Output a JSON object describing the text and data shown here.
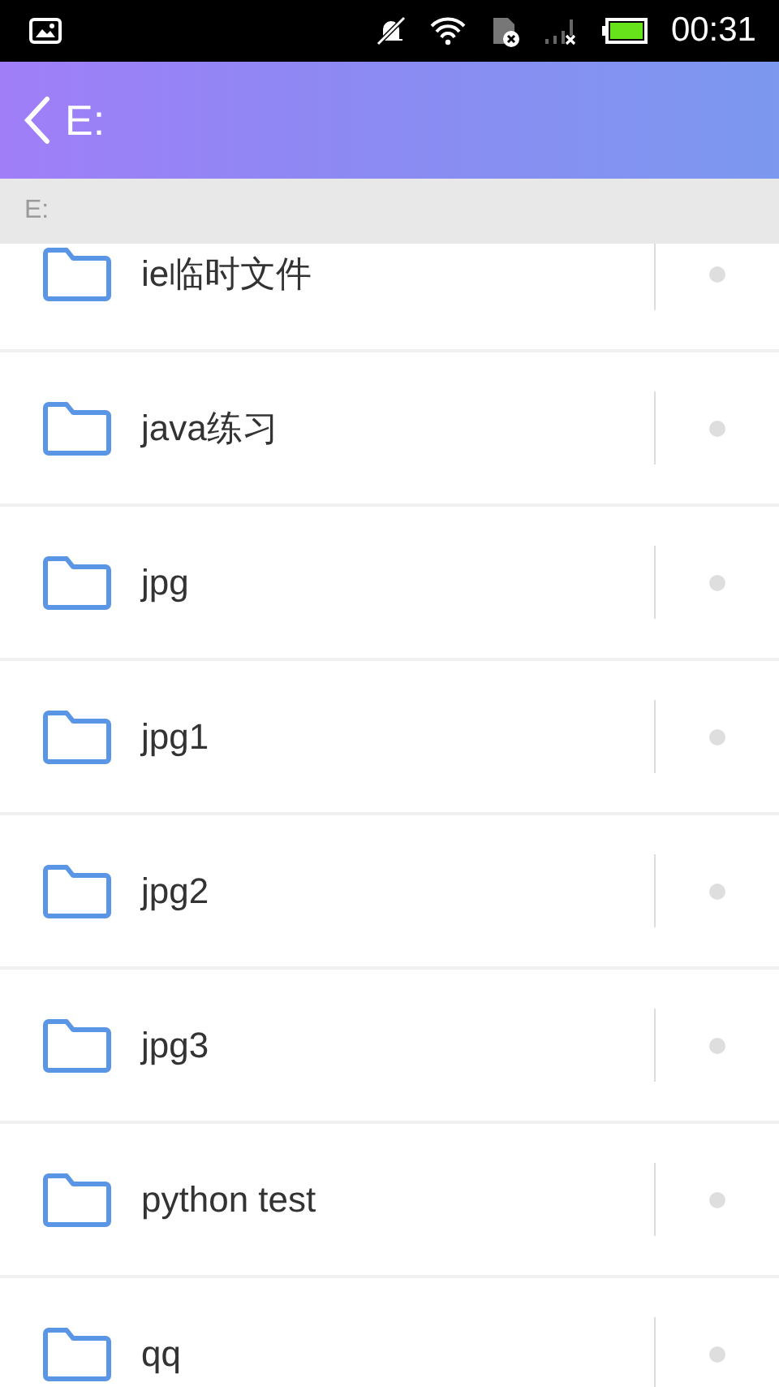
{
  "status_bar": {
    "time": "00:31"
  },
  "header": {
    "title": "E:"
  },
  "path_bar": {
    "path": "E:"
  },
  "folders": [
    {
      "name": "ie临时文件"
    },
    {
      "name": "java练习"
    },
    {
      "name": "jpg"
    },
    {
      "name": "jpg1"
    },
    {
      "name": "jpg2"
    },
    {
      "name": "jpg3"
    },
    {
      "name": "python test"
    },
    {
      "name": "qq"
    }
  ]
}
